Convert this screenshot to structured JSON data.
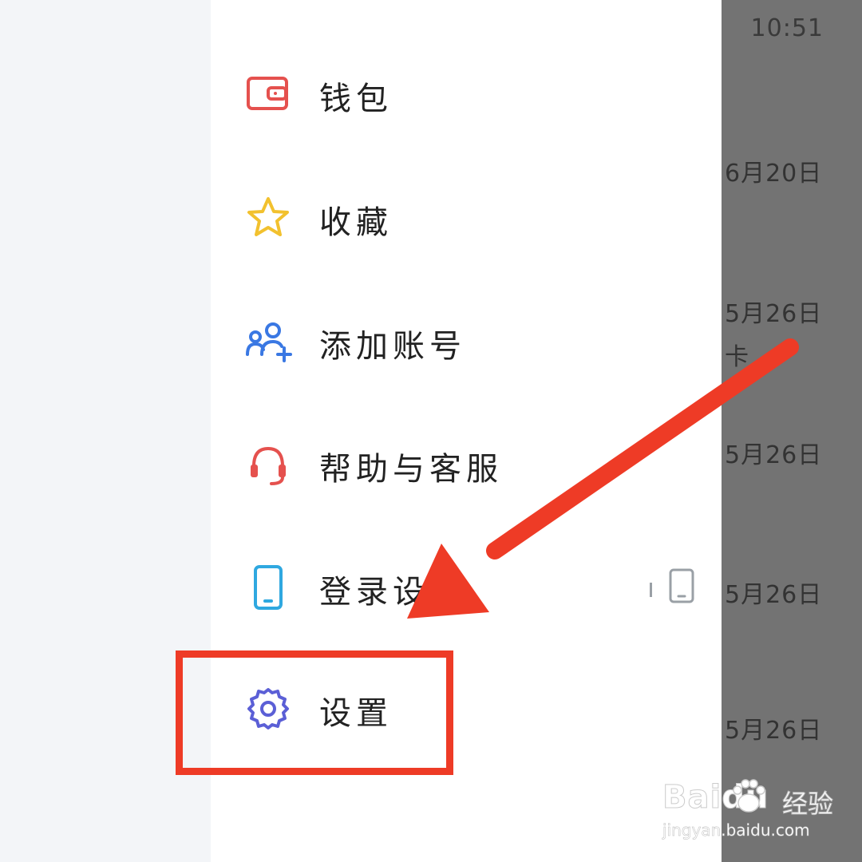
{
  "status_time": "10:51",
  "menu": [
    {
      "label": "钱包",
      "icon": "wallet-icon",
      "color": "#e5514e"
    },
    {
      "label": "收藏",
      "icon": "star-icon",
      "color": "#f2c12e"
    },
    {
      "label": "添加账号",
      "icon": "add-account-icon",
      "color": "#3a78e3"
    },
    {
      "label": "帮助与客服",
      "icon": "headset-icon",
      "color": "#e5514e"
    },
    {
      "label": "登录设",
      "icon": "phone-icon",
      "color": "#2fa8e0"
    },
    {
      "label": "设置",
      "icon": "gear-icon",
      "color": "#5b5fd6"
    }
  ],
  "background_dates": [
    "6月20日",
    "5月26日",
    "5月26日",
    "5月26日",
    "5月26日"
  ],
  "background_fragment": "卡",
  "watermark": {
    "brand": "Baidu",
    "cn": "经验",
    "url": "jingyan.baidu.com"
  },
  "colors": {
    "annotation": "#ee3b26",
    "overlay": "#737373"
  }
}
